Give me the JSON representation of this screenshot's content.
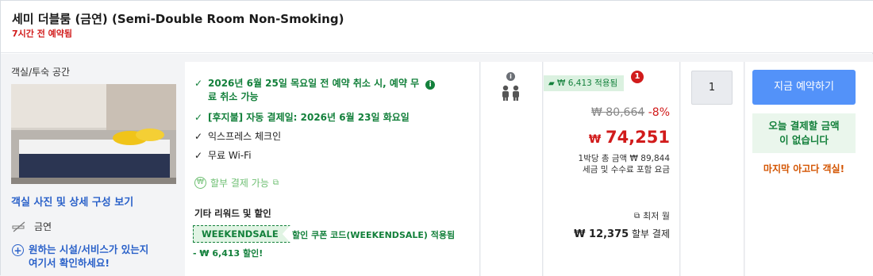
{
  "header": {
    "room_title": "세미 더블룸 (금연) (Semi-Double Room Non-Smoking)",
    "recent_booking": "7시간 전 예약됨"
  },
  "room": {
    "section_label": "객실/투숙 공간",
    "view_photos_link": "객실 사진 및 상세 구성 보기",
    "non_smoking": "금연",
    "facility_help_line1": "원하는 시설/서비스가 있는지",
    "facility_help_line2": "여기서 확인하세요!"
  },
  "benefits": {
    "cancellation_line1": "2026년 6월 25일 목요일 전 예약 취소 시, 예약 무",
    "cancellation_line2": "료 취소 가능",
    "auto_pay": "[후지불] 자동 결제일: 2026년 6월 23일 화요일",
    "express_checkin": "익스프레스 체크인",
    "wifi": "무료 Wi-Fi",
    "pay_later": "할부 결제 가능",
    "other_rewards_title": "기타 리워드 및 할인",
    "promo_code": "WEEKENDSALE",
    "promo_applied": "할인 쿠폰 코드(WEEKENDSALE) 적용됨",
    "promo_saving": "- ₩ 6,413 할인!"
  },
  "price": {
    "discount_badge": "₩ 6,413 적용됨",
    "badge_count": "1",
    "original": "₩ 80,664",
    "discount_pct": "-8%",
    "currency": "₩",
    "final": "74,251",
    "total_per_night": "1박당 총 금액 ₩ 89,844",
    "tax_note": "세금 및 수수료 포함 요금",
    "min_monthly": "최저 월",
    "installment_amount": "₩ 12,375",
    "installment_label": "할부 결제"
  },
  "quantity": {
    "value": "1"
  },
  "booking": {
    "book_button": "지금 예약하기",
    "no_payment_line1": "오늘 결제할 금액",
    "no_payment_line2": "이 없습니다",
    "last_chance": "마지막 아고다 객실!"
  },
  "colors": {
    "accent_blue": "#5392f9",
    "discount_red": "#d11b1b",
    "benefit_green": "#13803b",
    "urgency_orange": "#d35400"
  }
}
